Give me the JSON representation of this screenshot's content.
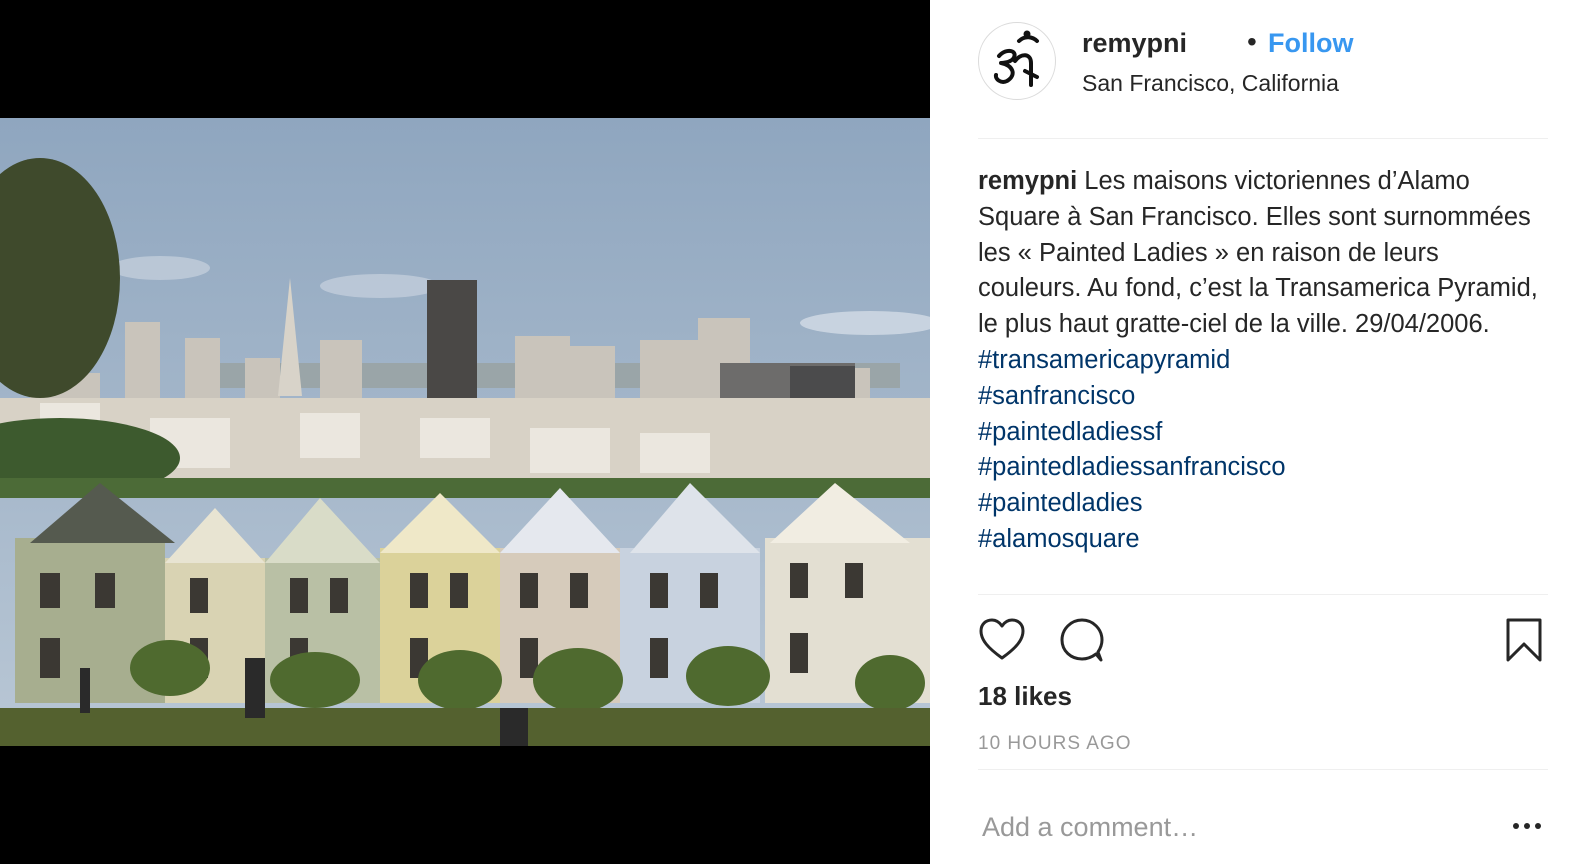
{
  "post": {
    "username": "remypni",
    "separator": "•",
    "follow_label": "Follow",
    "location": "San Francisco, California",
    "caption": {
      "author": "remypni",
      "text": "Les maisons victoriennes d’Alamo Square à San Francisco. Elles sont surnommées les « Painted Ladies » en raison de leurs couleurs. Au fond, c’est la Transamerica Pyramid, le plus haut gratte-ciel de la ville. 29/04/2006.",
      "hashtags": [
        "#transamericapyramid",
        "#sanfrancisco",
        "#paintedladiessf",
        "#paintedladiessanfrancisco",
        "#paintedladies",
        "#alamosquare"
      ]
    },
    "likes": "18 likes",
    "timestamp": "10 HOURS AGO",
    "comment_placeholder": "Add a comment…"
  },
  "icons": {
    "avatar": "om-symbol-avatar",
    "like": "heart-icon",
    "comment": "comment-bubble-icon",
    "save": "bookmark-icon",
    "more": "ellipsis-icon"
  },
  "colors": {
    "follow": "#3897f0",
    "hashtag": "#003569",
    "muted": "#999999",
    "text": "#262626",
    "divider": "#efefef"
  }
}
